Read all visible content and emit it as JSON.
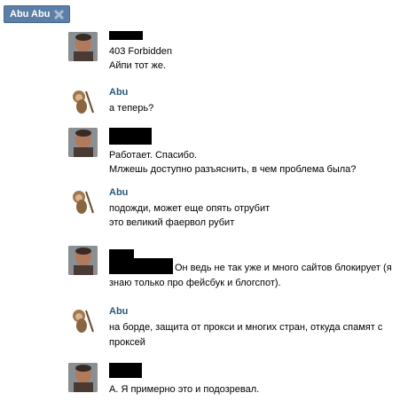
{
  "tab": {
    "title": "Abu Abu",
    "close_icon": "close-icon"
  },
  "messages": [
    {
      "author": "",
      "lines": [
        "403 Forbidden",
        "Айпи тот же."
      ]
    },
    {
      "author": "Abu",
      "lines": [
        "а теперь?"
      ]
    },
    {
      "author": "",
      "lines": [
        "Работает. Спасибо.",
        "Млжешь доступно разъяснить, в чем проблема была?"
      ]
    },
    {
      "author": "Abu",
      "lines": [
        "подожди, может еще опять отрубит",
        "это великий фаервол рубит"
      ]
    },
    {
      "author": "",
      "lines": [
        "Он ведь не так уже и много сайтов блокирует (я знаю только про фейсбук и блогспот)."
      ]
    },
    {
      "author": "Abu",
      "lines": [
        "на борде, защита от прокси и многих стран, откуда спамят с проксей"
      ]
    },
    {
      "author": "",
      "lines": [
        "А. Я примерно это и подозревал."
      ]
    }
  ],
  "colors": {
    "tab_bg": "#5b7fa6",
    "author": "#2b587a"
  }
}
